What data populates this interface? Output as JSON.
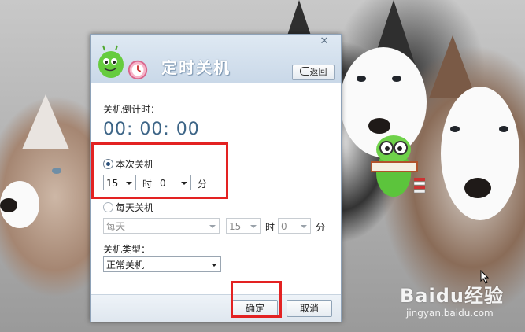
{
  "dialog": {
    "title": "定时关机",
    "close_glyph": "✕",
    "back_label": "返回"
  },
  "countdown": {
    "label": "关机倒计时：",
    "value": "00: 00: 00"
  },
  "once": {
    "label": "本次关机",
    "selected": true,
    "hour": "15",
    "hour_unit": "时",
    "minute": "0",
    "minute_unit": "分"
  },
  "daily": {
    "label": "每天关机",
    "selected": false,
    "frequency": "每天",
    "hour": "15",
    "hour_unit": "时",
    "minute": "0",
    "minute_unit": "分"
  },
  "shutdown_type": {
    "label": "关机类型：",
    "value": "正常关机"
  },
  "buttons": {
    "ok": "确定",
    "cancel": "取消"
  },
  "watermark": {
    "main": "Baidu经验",
    "sub": "jingyan.baidu.com"
  },
  "icons": [
    "close-icon",
    "back-arrow-icon",
    "mascot-icon",
    "clock-icon",
    "dropdown-arrow-icon",
    "cursor-icon",
    "reading-bug-icon"
  ],
  "colors": {
    "highlight": "#e32222",
    "countdown": "#3d6587",
    "title_bar": "#c9d8e8"
  }
}
